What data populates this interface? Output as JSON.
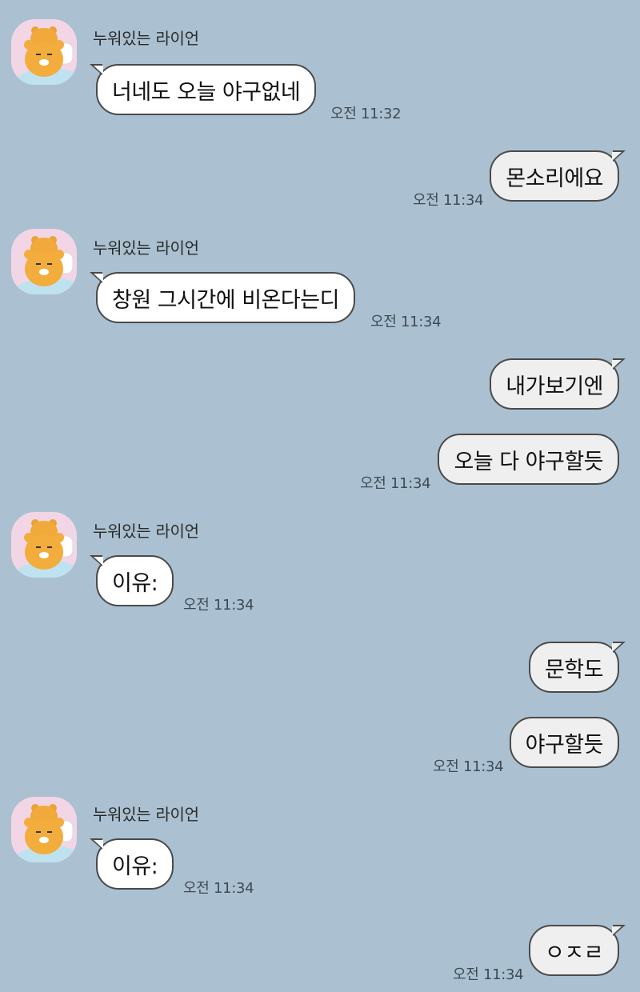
{
  "sender_name": "누워있는 라이언",
  "messages": [
    {
      "text": "너네도 오늘 야구없네",
      "time": "오전 11:32"
    },
    {
      "text": "몬소리에요",
      "time": "오전 11:34"
    },
    {
      "text": "창원 그시간에 비온다는디",
      "time": "오전 11:34"
    },
    {
      "text": "내가보기엔"
    },
    {
      "text": "오늘 다 야구할듯",
      "time": "오전 11:34"
    },
    {
      "text": "이유:",
      "time": "오전 11:34"
    },
    {
      "text": "문학도"
    },
    {
      "text": "야구할듯",
      "time": "오전 11:34"
    },
    {
      "text": "이유:",
      "time": "오전 11:34"
    },
    {
      "text": "ㅇㅈㄹ",
      "time": "오전 11:34"
    }
  ]
}
